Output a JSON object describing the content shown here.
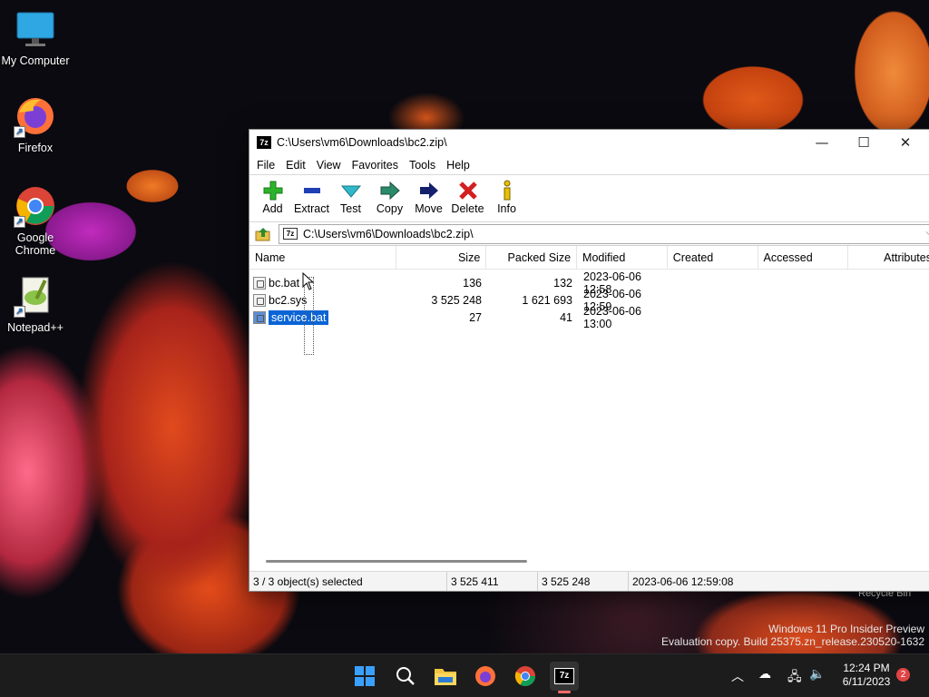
{
  "desktop": {
    "icons": [
      {
        "label": "My Computer"
      },
      {
        "label": "Firefox"
      },
      {
        "label": "Google Chrome"
      },
      {
        "label": "Notepad++"
      }
    ],
    "recycle_bin": "Recycle Bin",
    "watermark_line1": "Windows 11 Pro Insider Preview",
    "watermark_line2": "Evaluation copy. Build 25375.zn_release.230520-1632"
  },
  "window": {
    "title": "C:\\Users\\vm6\\Downloads\\bc2.zip\\",
    "app_icon_text": "7z",
    "menu": [
      "File",
      "Edit",
      "View",
      "Favorites",
      "Tools",
      "Help"
    ],
    "toolbar": [
      "Add",
      "Extract",
      "Test",
      "Copy",
      "Move",
      "Delete",
      "Info"
    ],
    "address": "C:\\Users\\vm6\\Downloads\\bc2.zip\\",
    "columns": [
      "Name",
      "Size",
      "Packed Size",
      "Modified",
      "Created",
      "Accessed",
      "Attributes"
    ],
    "files": [
      {
        "name": "bc.bat",
        "size": "136",
        "packed": "132",
        "modified": "2023-06-06 12:58"
      },
      {
        "name": "bc2.sys",
        "size": "3 525 248",
        "packed": "1 621 693",
        "modified": "2023-06-06 12:59"
      },
      {
        "name": "service.bat",
        "size": "27",
        "packed": "41",
        "modified": "2023-06-06 13:00"
      }
    ],
    "status": {
      "selection": "3 / 3 object(s) selected",
      "size": "3 525 411",
      "packed": "3 525 248",
      "modified": "2023-06-06 12:59:08"
    }
  },
  "taskbar": {
    "time": "12:24 PM",
    "date": "6/11/2023",
    "notifications": "2"
  },
  "colors": {
    "selection": "#0a64d6",
    "taskbar": "#1c1c1c"
  }
}
